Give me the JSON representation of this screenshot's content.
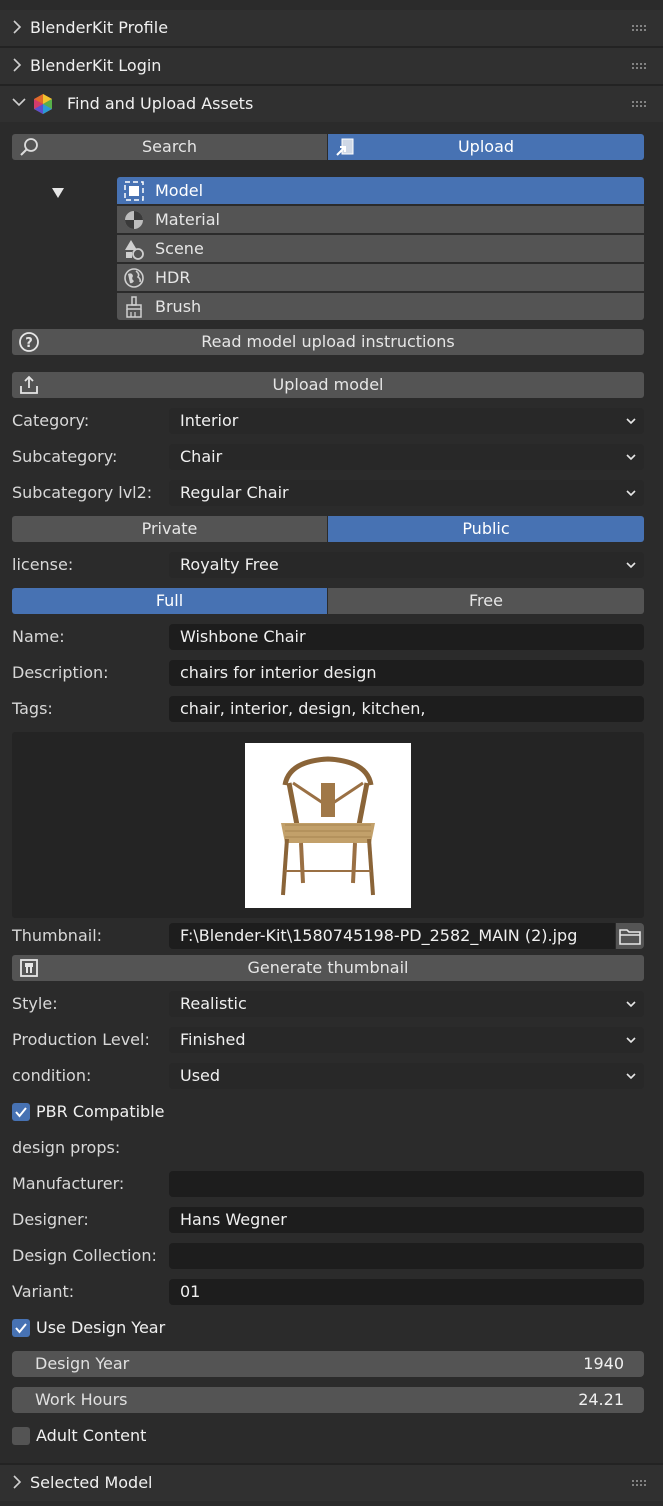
{
  "panels": {
    "profile": "BlenderKit Profile",
    "login": "BlenderKit Login",
    "find_upload": "Find and Upload Assets",
    "selected_model": "Selected Model"
  },
  "mode_tabs": {
    "search": "Search",
    "upload": "Upload"
  },
  "asset_types": [
    "Model",
    "Material",
    "Scene",
    "HDR",
    "Brush"
  ],
  "asset_type_selected": "Model",
  "buttons": {
    "instructions": "Read model upload instructions",
    "upload_model": "Upload model",
    "generate_thumbnail": "Generate thumbnail"
  },
  "fields": {
    "category_label": "Category:",
    "category": "Interior",
    "subcategory_label": "Subcategory:",
    "subcategory": "Chair",
    "subcategory2_label": "Subcategory lvl2:",
    "subcategory2": "Regular Chair",
    "license_label": "license:",
    "license": "Royalty Free",
    "name_label": "Name:",
    "name": "Wishbone Chair",
    "description_label": "Description:",
    "description": "chairs for interior design",
    "tags_label": "Tags:",
    "tags": "chair, interior, design, kitchen,",
    "thumbnail_label": "Thumbnail:",
    "thumbnail": "F:\\Blender-Kit\\1580745198-PD_2582_MAIN (2).jpg",
    "style_label": "Style:",
    "style": "Realistic",
    "production_label": "Production Level:",
    "production": "Finished",
    "condition_label": "condition:",
    "condition": "Used",
    "design_props_label": "design props:",
    "manufacturer_label": "Manufacturer:",
    "manufacturer": "",
    "designer_label": "Designer:",
    "designer": "Hans Wegner",
    "collection_label": "Design Collection:",
    "collection": "",
    "variant_label": "Variant:",
    "variant": "01"
  },
  "visibility": {
    "private": "Private",
    "public": "Public",
    "selected": "Public"
  },
  "pricing": {
    "full": "Full",
    "free": "Free",
    "selected": "Full"
  },
  "checkboxes": {
    "pbr": {
      "label": "PBR Compatible",
      "checked": true
    },
    "use_design_year": {
      "label": "Use Design Year",
      "checked": true
    },
    "adult": {
      "label": "Adult Content",
      "checked": false
    }
  },
  "numbers": {
    "design_year_label": "Design Year",
    "design_year": "1940",
    "work_hours_label": "Work Hours",
    "work_hours": "24.21"
  },
  "colors": {
    "accent": "#4772b3",
    "panel_bg": "#2b2b2b",
    "button": "#545454",
    "field": "#1d1d1d"
  }
}
